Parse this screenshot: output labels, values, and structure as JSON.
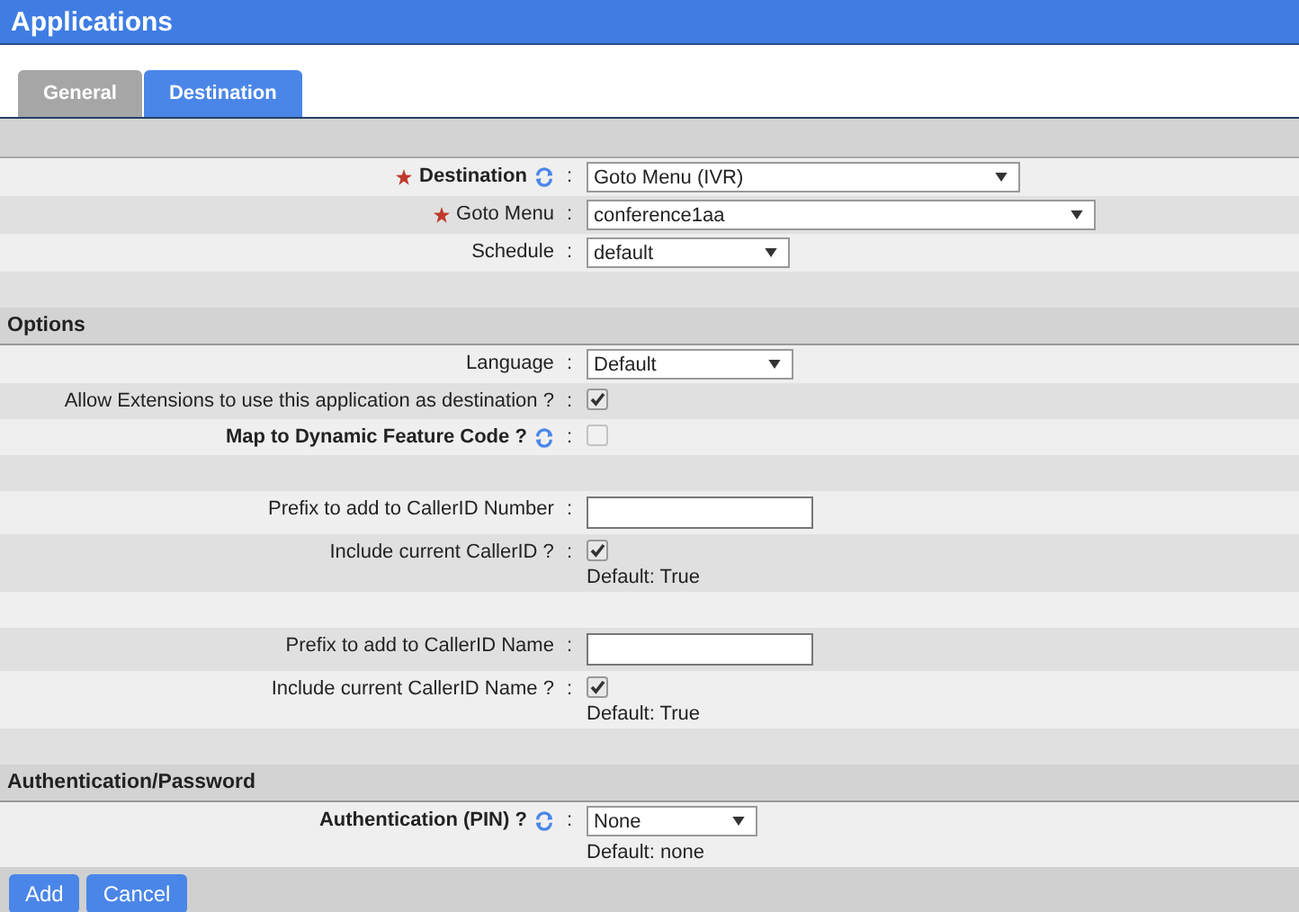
{
  "window": {
    "title": "Applications"
  },
  "tabs": [
    {
      "label": "General",
      "selected": false
    },
    {
      "label": "Destination",
      "selected": true
    }
  ],
  "sections": [
    {
      "rows": [
        {
          "kind": "select",
          "label": "Destination",
          "bold": true,
          "required": true,
          "refresh": true,
          "separator": ":",
          "value": "Goto Menu (IVR)"
        },
        {
          "kind": "select",
          "label": "Goto Menu",
          "bold": false,
          "required": true,
          "refresh": false,
          "separator": ":",
          "value": "conference1aa"
        },
        {
          "kind": "select",
          "label": "Schedule",
          "bold": false,
          "required": false,
          "refresh": false,
          "separator": ":",
          "value": "default"
        },
        {
          "kind": "blank"
        }
      ]
    },
    {
      "title": "Options",
      "rows": [
        {
          "kind": "select",
          "label": "Language",
          "bold": false,
          "required": false,
          "refresh": false,
          "separator": ":",
          "value": "Default"
        },
        {
          "kind": "checkbox",
          "label": "Allow Extensions to use this application as destination ?",
          "bold": false,
          "required": false,
          "refresh": false,
          "separator": ":",
          "checked": true,
          "disabled": false
        },
        {
          "kind": "checkbox",
          "label": "Map to Dynamic Feature Code ?",
          "bold": true,
          "required": false,
          "refresh": true,
          "separator": ":",
          "checked": false,
          "disabled": true
        },
        {
          "kind": "blank"
        },
        {
          "kind": "text",
          "label": "Prefix to add to CallerID Number",
          "bold": false,
          "required": false,
          "refresh": false,
          "separator": ":"
        },
        {
          "kind": "checkbox",
          "label": "Include current CallerID ?",
          "bold": false,
          "required": false,
          "refresh": false,
          "separator": ":",
          "checked": true,
          "disabled": false,
          "note": "Default: True"
        },
        {
          "kind": "blank"
        },
        {
          "kind": "text",
          "label": "Prefix to add to CallerID Name",
          "bold": false,
          "required": false,
          "refresh": false,
          "separator": ":"
        },
        {
          "kind": "checkbox",
          "label": "Include current CallerID Name ?",
          "bold": false,
          "required": false,
          "refresh": false,
          "separator": ":",
          "checked": true,
          "disabled": false,
          "note": "Default: True"
        },
        {
          "kind": "blank"
        }
      ]
    },
    {
      "title": "Authentication/Password",
      "rows": [
        {
          "kind": "select",
          "label": "Authentication (PIN) ?",
          "bold": true,
          "required": false,
          "refresh": true,
          "separator": ":",
          "value": "None",
          "note": "Default: none"
        }
      ]
    }
  ],
  "buttons": [
    {
      "label": "Add"
    },
    {
      "label": "Cancel"
    }
  ]
}
